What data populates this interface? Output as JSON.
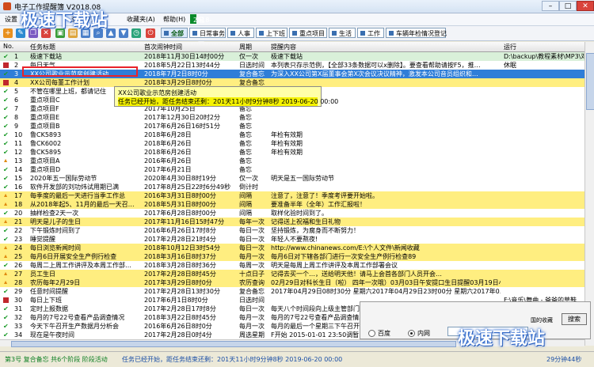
{
  "window": {
    "title": "电子工作提醒簿 V2018.08"
  },
  "menu": {
    "items": [
      "设置",
      "查询(V)",
      "收藏夹(A)",
      "帮助(H)"
    ],
    "clock_date": "2018-11-30 12:50:51",
    "weekday": "星期五"
  },
  "toolbar": {
    "tabs": [
      "全部",
      "日常事务",
      "人事",
      "上下班",
      "重点项目",
      "生活",
      "工作",
      "车辆年检情况登记"
    ]
  },
  "columns": [
    "No.",
    "任务标题",
    "首次闹钟时间",
    "周期",
    "提醒内容",
    "运行"
  ],
  "rows": [
    {
      "no": "1",
      "title": "极速下载站",
      "time": "2018年11月30日14时00分",
      "cycle": "仅一次",
      "content": "极速下载站",
      "run": "D:\\backup\\教程素材\\MP3\\邓紫",
      "bg": "#d9f0d9",
      "icon": "check"
    },
    {
      "no": "2",
      "title": "每日天气",
      "time": "2018年5月22日13时44分",
      "cycle": "日选时间",
      "content": "本列表只存示范例，【全部33条数据可以x删除】。要查看帮助请按F5，推…",
      "run": "休眠",
      "bg": "#ffffff",
      "icon": "bar"
    },
    {
      "no": "3",
      "title": "XX公司歌业示范房创建活动",
      "time": "2018年7月2日8时0分",
      "cycle": "复合备忘",
      "content": "为深入XX公司第X届董事会第X次会议决议精神，激发本公司音员组织和…",
      "run": "",
      "bg": "#2f7ed8",
      "icon": "check",
      "selected": true
    },
    {
      "no": "4",
      "title": "XX公司每董工作计划",
      "time": "2018年3月29日8时0分",
      "cycle": "复合备忘",
      "content": "",
      "run": "",
      "bg": "#ffee80",
      "icon": "bar"
    },
    {
      "no": "5",
      "title": "不管在哪里上班，都请记住",
      "time": "",
      "cycle": "",
      "content": "",
      "run": "",
      "bg": "#ffffff",
      "icon": "check"
    },
    {
      "no": "6",
      "title": "重点项目C",
      "time": "",
      "cycle": "",
      "content": "",
      "run": "",
      "bg": "#ffffff",
      "icon": "check"
    },
    {
      "no": "7",
      "title": "重点项目F",
      "time": "2017年10月25日",
      "cycle": "备忘",
      "content": "",
      "run": "",
      "bg": "#ffffff",
      "icon": "check"
    },
    {
      "no": "8",
      "title": "重点项目E",
      "time": "2017年12月30日20时2分",
      "cycle": "备忘",
      "content": "",
      "run": "",
      "bg": "#ffffff",
      "icon": "check"
    },
    {
      "no": "9",
      "title": "重点项目B",
      "time": "2017年6月26日16时51分",
      "cycle": "备忘",
      "content": "",
      "run": "",
      "bg": "#ffffff",
      "icon": "check"
    },
    {
      "no": "10",
      "title": "鲁CK5893",
      "time": "2018年6月28日",
      "cycle": "备忘",
      "content": "年检有效期",
      "run": "",
      "bg": "#ffffff",
      "icon": "check"
    },
    {
      "no": "11",
      "title": "鲁CK6002",
      "time": "2018年6月26日",
      "cycle": "备忘",
      "content": "年检有效期",
      "run": "",
      "bg": "#ffffff",
      "icon": "check"
    },
    {
      "no": "12",
      "title": "鲁CK5895",
      "time": "2018年6月26日",
      "cycle": "备忘",
      "content": "年检有效期",
      "run": "",
      "bg": "#ffffff",
      "icon": "check"
    },
    {
      "no": "13",
      "title": "重点项目A",
      "time": "2016年6月26日",
      "cycle": "备忘",
      "content": "",
      "run": "",
      "bg": "#ffffff",
      "icon": "warn"
    },
    {
      "no": "14",
      "title": "重点项目D",
      "time": "2017年6月21日",
      "cycle": "备忘",
      "content": "",
      "run": "",
      "bg": "#ffffff",
      "icon": "check"
    },
    {
      "no": "15",
      "title": "2020年五一国际劳动节",
      "time": "2020年4月30日8时19分",
      "cycle": "仅一次",
      "content": "明天是五一国际劳动节",
      "run": "",
      "bg": "#ffffff",
      "icon": "check"
    },
    {
      "no": "16",
      "title": "软件开发部的刘功炜试用期已满",
      "time": "2017年8月25日22时6分49秒",
      "cycle": "倒计时",
      "content": "",
      "run": "",
      "bg": "#ffffff",
      "icon": "check"
    },
    {
      "no": "17",
      "title": "每季度的最后一天进行当季工作总",
      "time": "2016年3月31日8时00分",
      "cycle": "间隔",
      "content": "注意了，注意了！季度考评要开始啦。",
      "run": "",
      "bg": "#ffee80",
      "icon": "warn"
    },
    {
      "no": "18",
      "title": "从2018年起5、11月的最后一天召…",
      "time": "2018年5月31日8时00分",
      "cycle": "间隔",
      "content": "要准备半年（全年）工作汇报啦！",
      "run": "",
      "bg": "#ffee80",
      "icon": "warn"
    },
    {
      "no": "20",
      "title": "抽样检查2天一次",
      "time": "2017年6月28日8时00分",
      "cycle": "间隔",
      "content": "取样化验时间到了。",
      "run": "",
      "bg": "#ffffff",
      "icon": "check"
    },
    {
      "no": "21",
      "title": "明天是儿子的生日",
      "time": "2017年11月16日15时47分",
      "cycle": "每年一次",
      "content": "记得送上祝福和生日礼物",
      "run": "",
      "bg": "#ffee80",
      "icon": "warn"
    },
    {
      "no": "22",
      "title": "下午锻炼时间到了",
      "time": "2016年6月26日17时8分",
      "cycle": "每日一次",
      "content": "坚持锻炼，为腐身而不断努力！",
      "run": "",
      "bg": "#ffffff",
      "icon": "check"
    },
    {
      "no": "23",
      "title": "睡觉提醒",
      "time": "2017年2月28日21时4分",
      "cycle": "每日一次",
      "content": "年轻人不要熬夜!",
      "run": "",
      "bg": "#ffffff",
      "icon": "check"
    },
    {
      "no": "24",
      "title": "每日浏览新闻时间",
      "time": "2018年10月12日3时54分",
      "cycle": "每日一次",
      "content": "http://www.chinanews.com/E:\\个人文件\\新闻收藏",
      "run": "",
      "bg": "#ffee80",
      "icon": "warn"
    },
    {
      "no": "25",
      "title": "每月6日开展安全生产例行检查",
      "time": "2018年3月16日8时37分",
      "cycle": "每月一次",
      "content": "每月6日对下辖各部门进行一次安全生产例行检查89",
      "run": "",
      "bg": "#ffee80",
      "icon": "warn"
    },
    {
      "no": "26",
      "title": "每周二上周工作讲评及本周工作部…",
      "time": "2018年3月28日8时36分",
      "cycle": "每周一次",
      "content": "明天是每周上周工作讲评及本周工作部署会议",
      "run": "",
      "bg": "#ffffff",
      "icon": "check"
    },
    {
      "no": "27",
      "title": "员工生日",
      "time": "2017年2月28日8时45分",
      "cycle": "十点日子",
      "content": "记得去买一个…，送给明天他！请马上会首各部门人员开会…",
      "run": "",
      "bg": "#ffee80",
      "icon": "warn"
    },
    {
      "no": "28",
      "title": "农历每年2月29日",
      "time": "2017年3月29日8时0分",
      "cycle": "农历查询",
      "content": "02月29日对科长生日（啦） 四年一次哦）03月03日午安提口生日提醒03月19日小…",
      "run": "",
      "bg": "#ffee80",
      "icon": "warn"
    },
    {
      "no": "29",
      "title": "任意时间提醒",
      "time": "2017年2月28日13时30分",
      "cycle": "复合备忘",
      "content": "2017年04月29日08时30分 星期六2017年04月29日23时00分 星期六2017年0…",
      "run": "",
      "bg": "#ffffff",
      "icon": "check"
    },
    {
      "no": "30",
      "title": "每日上下班",
      "time": "2017年6月1日8时0分",
      "cycle": "日选时间",
      "content": "",
      "run": "F:\\音乐\\舞曲 - 爸爸的草鞋.",
      "bg": "#ffffff",
      "icon": "bar"
    },
    {
      "no": "31",
      "title": "定时上报数据",
      "time": "2017年2月28日17时8分",
      "cycle": "每日一次",
      "content": "每天八个时间段向上级主管部门报告相关数据",
      "run": "",
      "bg": "#ffffff",
      "icon": "check"
    },
    {
      "no": "32",
      "title": "每月的7号22号查看产品调查情况",
      "time": "2018年3月22日8时45分",
      "cycle": "每月一次",
      "content": "每月的7号22号查看产品调查情况。",
      "run": "",
      "bg": "#ffffff",
      "icon": "check"
    },
    {
      "no": "33",
      "title": "今天下午召开生产数据月分析会",
      "time": "2016年6月26日8时0分",
      "cycle": "每月一次",
      "content": "每月的最后一个星期三下午召开…",
      "run": "",
      "bg": "#ffffff",
      "icon": "check"
    },
    {
      "no": "34",
      "title": "现在是午夜时间",
      "time": "2017年2月28日0时4分",
      "cycle": "周选星期",
      "content": "F开始 2015-01-01 23:50调暂…",
      "run": "",
      "bg": "#ffffff",
      "icon": "check"
    },
    {
      "no": "35",
      "title": "每天上班时候",
      "time": "2017年2月28日8时30分",
      "cycle": "周选星期",
      "content": "又是一个新的工作日，向上吧！…",
      "run": "",
      "bg": "#ffffff",
      "icon": "check"
    }
  ],
  "tooltip": {
    "line1": "XX公司歌业示范房创建活动",
    "line2": "任务已经开始，距任务结束还剩：201天11小时9分钟8秒 2019-06-20 00:00"
  },
  "search": {
    "option1": "百度",
    "option2": "内网",
    "button": "搜索",
    "right_label": "国的收藏"
  },
  "status": {
    "left": "第3号 复合备忘 共6个阶段 阶段活动",
    "middle": "任务已经开始，距任务结束还剩：201天11小时9分钟8秒 2019-06-20 00:00",
    "right": "29分钟44秒"
  },
  "watermark": {
    "text": "极速下载站"
  }
}
